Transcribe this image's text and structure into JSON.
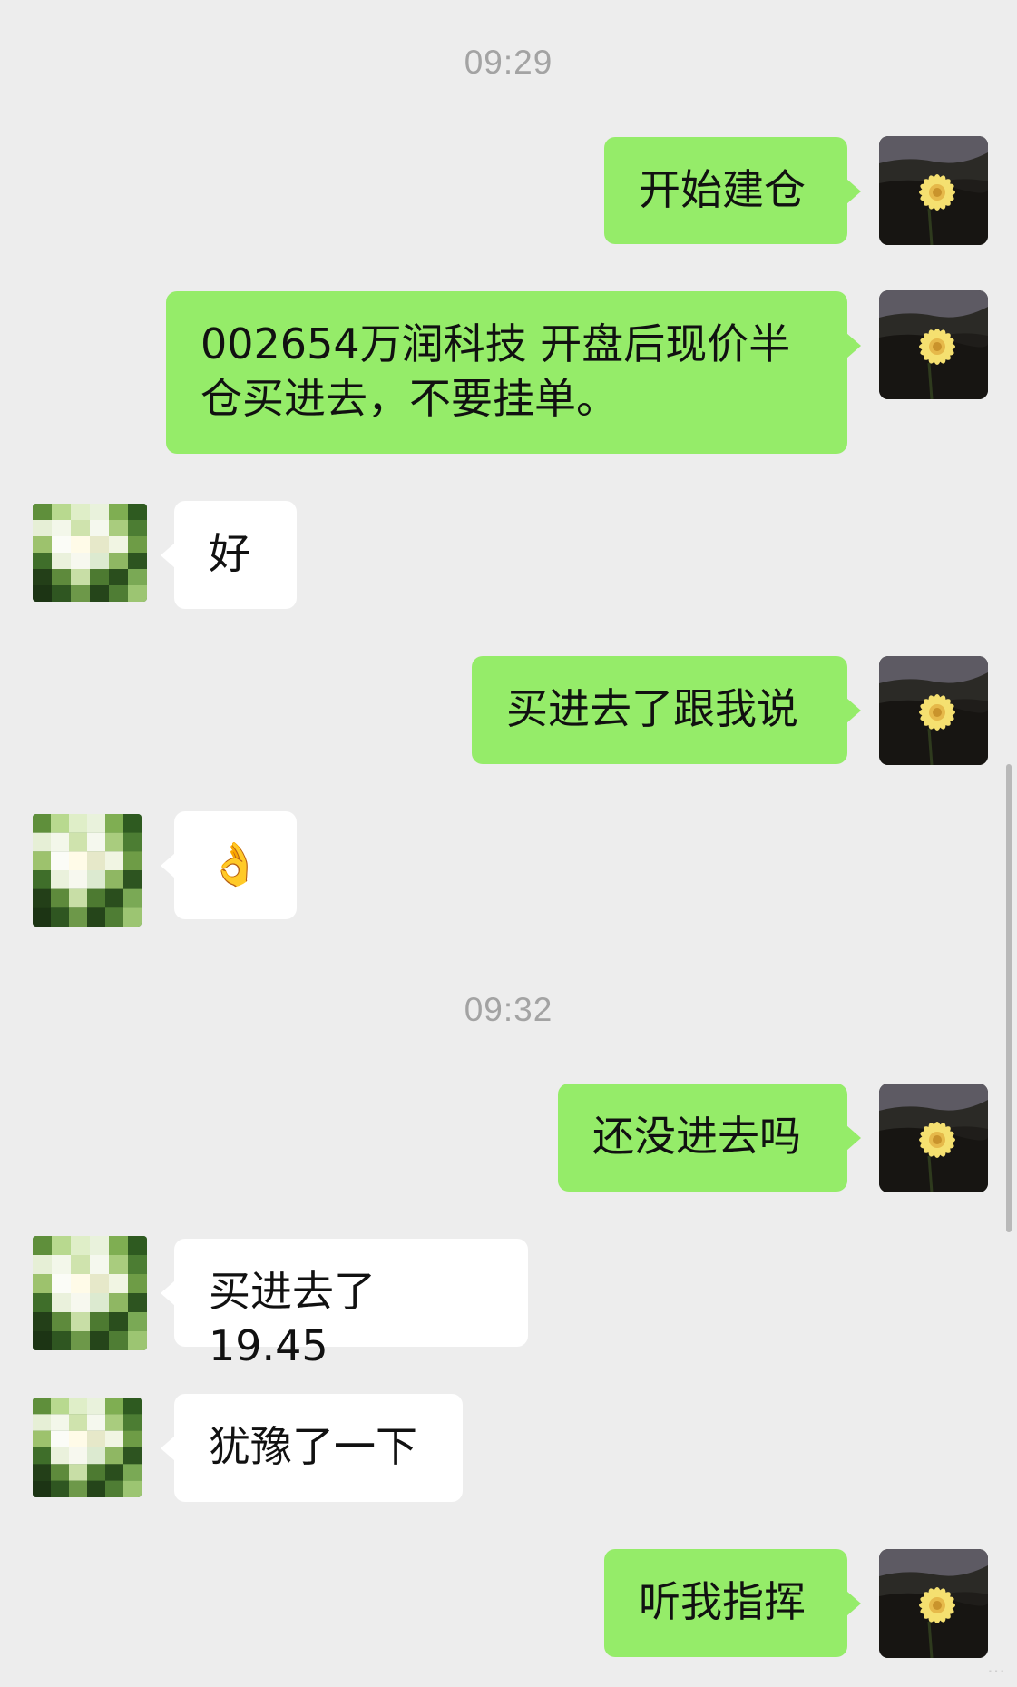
{
  "colors": {
    "background": "#ededed",
    "outgoing_bubble": "#95ec69",
    "incoming_bubble": "#ffffff",
    "timestamp_text": "#a3a3a3"
  },
  "messages": [
    {
      "type": "timestamp",
      "text": "09:29"
    },
    {
      "type": "outgoing",
      "text": "开始建仓",
      "avatar": "sunflower-avatar-icon"
    },
    {
      "type": "outgoing",
      "line1": "002654万润科技 开盘后现价半",
      "line2": "仓买进去，不要挂单。",
      "avatar": "sunflower-avatar-icon"
    },
    {
      "type": "incoming",
      "text": "好",
      "avatar": "pixelated-avatar-icon"
    },
    {
      "type": "outgoing",
      "text": "买进去了跟我说",
      "avatar": "sunflower-avatar-icon"
    },
    {
      "type": "incoming",
      "text": "👌",
      "avatar": "pixelated-avatar-icon"
    },
    {
      "type": "timestamp",
      "text": "09:32"
    },
    {
      "type": "outgoing",
      "text": "还没进去吗",
      "avatar": "sunflower-avatar-icon"
    },
    {
      "type": "incoming",
      "text": "买进去了19.45",
      "avatar": "pixelated-avatar-icon"
    },
    {
      "type": "incoming",
      "text": "犹豫了一下",
      "avatar": "pixelated-avatar-icon"
    },
    {
      "type": "outgoing",
      "text": "听我指挥",
      "avatar": "sunflower-avatar-icon"
    }
  ]
}
